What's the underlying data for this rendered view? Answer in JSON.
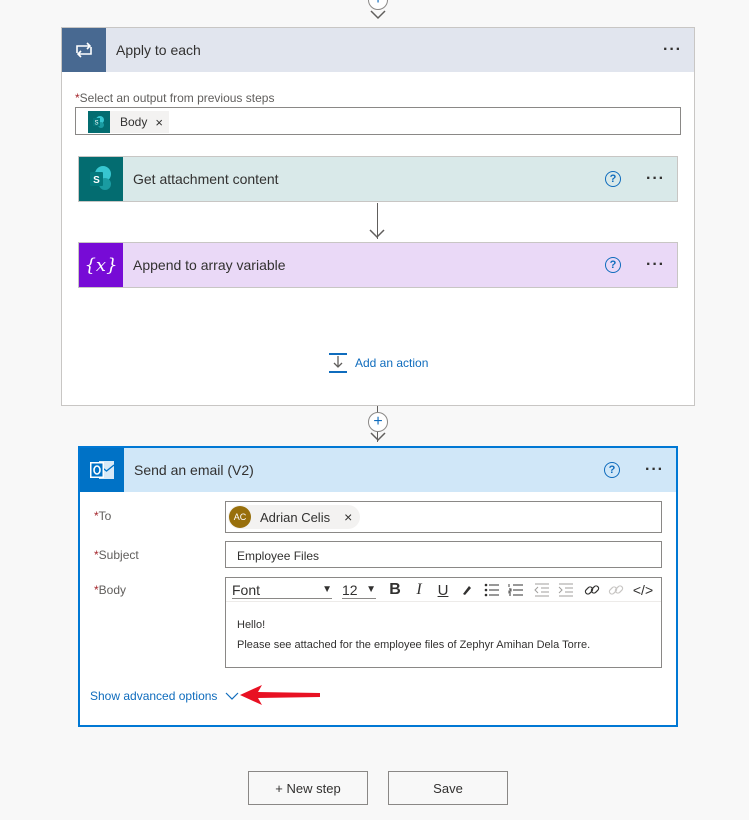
{
  "apply_to_each": {
    "title": "Apply to each",
    "more": "···",
    "select_label": "Select an output from previous steps",
    "required_mark": "*",
    "token": {
      "label": "Body",
      "remove": "×",
      "icon": "sharepoint-icon"
    },
    "actions": [
      {
        "title": "Get attachment content",
        "help": "?",
        "more": "···",
        "icon": "sharepoint-icon",
        "color": "#036c70",
        "bg": "#d9e9e9"
      },
      {
        "title": "Append to array variable",
        "help": "?",
        "more": "···",
        "icon": "variable-icon",
        "icon_text": "{x}",
        "color": "#770bd6",
        "bg": "#ead9f7"
      }
    ],
    "add_action": "Add an action"
  },
  "email": {
    "title": "Send an email (V2)",
    "help": "?",
    "more": "···",
    "fields": {
      "to_label": "To",
      "subject_label": "Subject",
      "body_label": "Body",
      "required_mark": "*"
    },
    "to": {
      "initials": "AC",
      "name": "Adrian Celis",
      "remove": "×"
    },
    "subject": "Employee Files",
    "toolbar": {
      "font": "Font",
      "size": "12",
      "bold": "B",
      "italic": "I",
      "underline": "U",
      "code": "</>"
    },
    "body_lines": [
      "Hello!",
      "Please see attached for the employee files of Zephyr Amihan Dela Torre."
    ],
    "show_advanced": "Show advanced options"
  },
  "buttons": {
    "new_step": "+ New step",
    "save": "Save"
  },
  "colors": {
    "accent": "#0078d4",
    "apply_header": "#e1e5ee",
    "email_header": "#d0e7f8",
    "annotation_arrow": "#e81123"
  }
}
